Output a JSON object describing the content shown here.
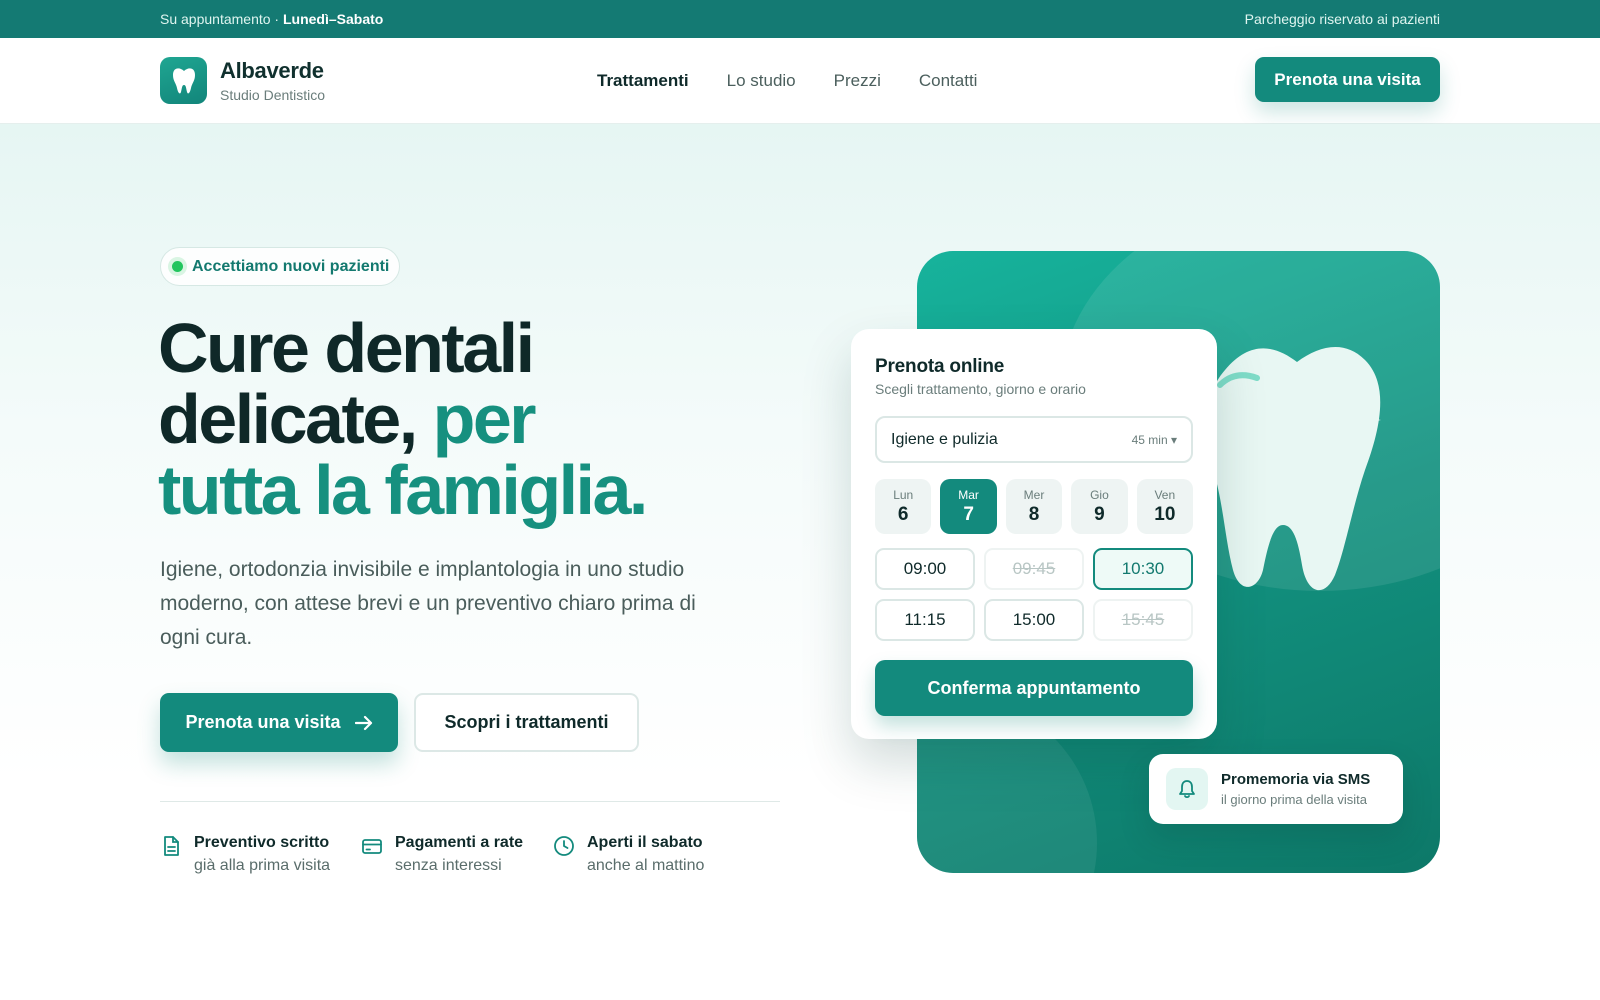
{
  "topbar": {
    "left_prefix": "Su appuntamento · ",
    "left_days": "Lunedì–Sabato",
    "right": "Parcheggio riservato ai pazienti"
  },
  "brand": {
    "name": "Albaverde",
    "subtitle": "Studio Dentistico",
    "logo_icon": "tooth-icon"
  },
  "nav": {
    "items": [
      {
        "label": "Trattamenti",
        "active": true
      },
      {
        "label": "Lo studio",
        "active": false
      },
      {
        "label": "Prezzi",
        "active": false
      },
      {
        "label": "Contatti",
        "active": false
      }
    ],
    "cta": "Prenota una visita"
  },
  "hero": {
    "badge": "Accettiamo nuovi pazienti",
    "title_line1": "Cure dentali",
    "title_line2a": "delicate, ",
    "title_line2b": "per",
    "title_line3": "tutta la famiglia.",
    "description": "Igiene, ortodonzia invisibile e implantologia in uno studio moderno, con attese brevi e un preventivo chiaro prima di ogni cura.",
    "primary_button": "Prenota una visita",
    "secondary_button": "Scopri i trattamenti"
  },
  "features": [
    {
      "icon": "document-icon",
      "title": "Preventivo scritto",
      "subtitle": "già alla prima visita"
    },
    {
      "icon": "credit-card-icon",
      "title": "Pagamenti a rate",
      "subtitle": "senza interessi"
    },
    {
      "icon": "clock-icon",
      "title": "Aperti il sabato",
      "subtitle": "anche al mattino"
    }
  ],
  "booking": {
    "title": "Prenota online",
    "subtitle": "Scegli trattamento, giorno e orario",
    "treatment": "Igiene e pulizia",
    "duration": "45 min ▾",
    "days": [
      {
        "name": "Lun",
        "num": "6",
        "selected": false
      },
      {
        "name": "Mar",
        "num": "7",
        "selected": true
      },
      {
        "name": "Mer",
        "num": "8",
        "selected": false
      },
      {
        "name": "Gio",
        "num": "9",
        "selected": false
      },
      {
        "name": "Ven",
        "num": "10",
        "selected": false
      }
    ],
    "slots": [
      {
        "time": "09:00",
        "state": "available"
      },
      {
        "time": "09:45",
        "state": "unavailable"
      },
      {
        "time": "10:30",
        "state": "selected"
      },
      {
        "time": "11:15",
        "state": "available"
      },
      {
        "time": "15:00",
        "state": "available"
      },
      {
        "time": "15:45",
        "state": "unavailable"
      }
    ],
    "confirm": "Conferma appuntamento"
  },
  "toast": {
    "title": "Promemoria via SMS",
    "subtitle": "il giorno prima della visita",
    "icon": "bell-icon"
  },
  "colors": {
    "brand": "#138a7d",
    "brand_dark": "#147a73",
    "accent_text": "#16907f",
    "status_dot": "#22c55e"
  }
}
